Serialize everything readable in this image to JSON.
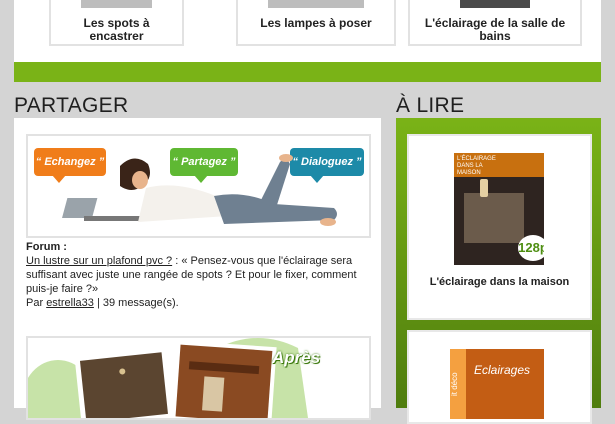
{
  "top_cards": [
    {
      "label": "Les spots à encastrer"
    },
    {
      "label": "Les lampes à poser"
    },
    {
      "label": "L'éclairage de la salle de bains"
    }
  ],
  "share": {
    "heading": "PARTAGER",
    "banner": {
      "echangez": "Echangez",
      "partagez": "Partagez",
      "dialoguez": "Dialoguez"
    },
    "forum": {
      "label": "Forum :",
      "link": "Un lustre sur un plafond pvc ?",
      "separator": " : ",
      "quote": "« Pensez-vous que l'éclairage sera suffisant avec juste une rangée de spots ? Et pour le fixer, comment puis-je faire ?»",
      "by": "Par ",
      "author": "estrella33",
      "count": " | 39 message(s)."
    },
    "apres": "Après"
  },
  "read": {
    "heading": "À LIRE",
    "book1": {
      "cover_title": "L'ÉCLAIRAGE DANS LA MAISON",
      "price": "128p",
      "title": "L'éclairage dans la maison"
    },
    "book2": {
      "cover_side": "it déco",
      "cover_title": "Eclairages"
    }
  },
  "colors": {
    "accent": "#7ab317",
    "orange": "#f07d1a",
    "green": "#5fb833",
    "teal": "#1d8aa8"
  }
}
